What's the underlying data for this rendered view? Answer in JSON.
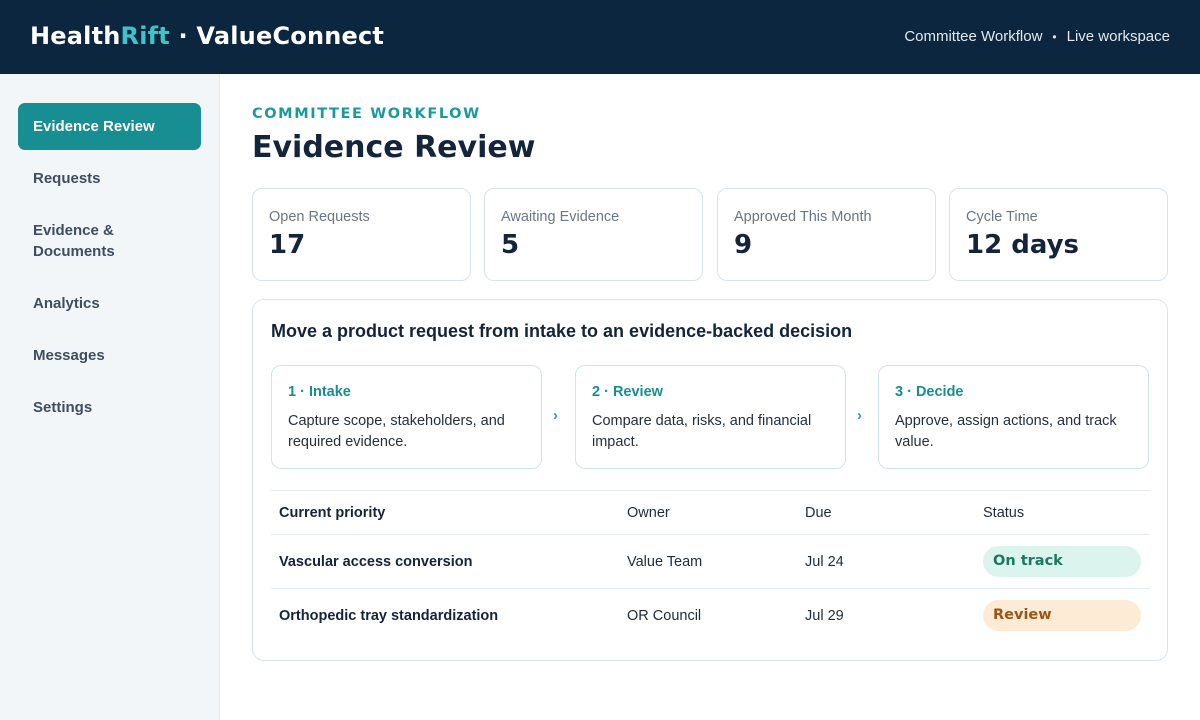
{
  "header": {
    "brand_part1": "Health",
    "brand_part2": "Rift",
    "brand_part3": " · ValueConnect",
    "nav_workflow": "Committee Workflow",
    "nav_separator": "•",
    "nav_workspace": "Live workspace"
  },
  "sidebar": {
    "items": [
      {
        "label": "Evidence Review",
        "active": true
      },
      {
        "label": "Requests"
      },
      {
        "label": "Evidence & Documents"
      },
      {
        "label": "Analytics"
      },
      {
        "label": "Messages"
      },
      {
        "label": "Settings"
      }
    ]
  },
  "main": {
    "eyebrow": "COMMITTEE WORKFLOW",
    "title": "Evidence Review",
    "stats": [
      {
        "label": "Open Requests",
        "value": "17"
      },
      {
        "label": "Awaiting Evidence",
        "value": "5"
      },
      {
        "label": "Approved This Month",
        "value": "9"
      },
      {
        "label": "Cycle Time",
        "value": "12 days"
      }
    ],
    "panel": {
      "title": "Move a product request from intake to an evidence-backed decision",
      "steps": [
        {
          "title": "1 · Intake",
          "desc": "Capture scope, stakeholders, and required evidence."
        },
        {
          "title": "2 · Review",
          "desc": "Compare data, risks, and financial impact."
        },
        {
          "title": "3 · Decide",
          "desc": "Approve, assign actions, and track value."
        }
      ],
      "step_arrow": "›",
      "table": {
        "headers": [
          "Current priority",
          "Owner",
          "Due",
          "Status"
        ],
        "rows": [
          {
            "priority": "Vascular access conversion",
            "owner": "Value Team",
            "due": "Jul 24",
            "status": "On track"
          },
          {
            "priority": "Orthopedic tray standardization",
            "owner": "OR Council",
            "due": "Jul 29",
            "status": "Review"
          }
        ]
      }
    }
  },
  "colors": {
    "header_bg": "#0d2640",
    "accent": "#178e91",
    "brand_accent": "#3fc3c9",
    "on_track_bg": "#dcf4ee",
    "review_bg": "#fdebd6"
  }
}
